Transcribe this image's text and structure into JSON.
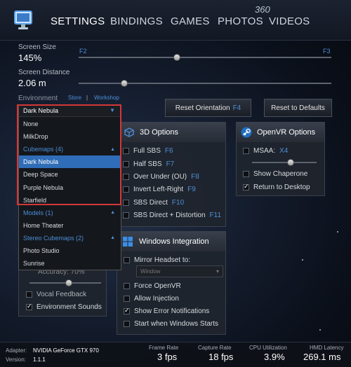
{
  "nav": {
    "tabs": [
      "SETTINGS",
      "BINDINGS",
      "GAMES",
      "PHOTOS",
      "VIDEOS"
    ],
    "photos_badge": "360"
  },
  "screen_size": {
    "label": "Screen Size",
    "value": "145%",
    "key_left": "F2",
    "key_right": "F3",
    "level": 0.39
  },
  "screen_distance": {
    "label": "Screen Distance",
    "value": "2.06 m",
    "level": 0.18
  },
  "environment": {
    "label": "Environment",
    "store": "Store",
    "workshop": "Workshop",
    "selected": "Dark Nebula",
    "list": [
      {
        "text": "None",
        "kind": "item"
      },
      {
        "text": "MilkDrop",
        "kind": "item"
      },
      {
        "text": "Cubemaps (4)",
        "kind": "category"
      },
      {
        "text": "Dark Nebula",
        "kind": "selected"
      },
      {
        "text": "Deep Space",
        "kind": "item"
      },
      {
        "text": "Purple Nebula",
        "kind": "item"
      },
      {
        "text": "Starfield",
        "kind": "item"
      },
      {
        "text": "Models (1)",
        "kind": "category"
      },
      {
        "text": "Home Theater",
        "kind": "item"
      },
      {
        "text": "Stereo Cubemaps (2)",
        "kind": "category"
      },
      {
        "text": "Photo Studio",
        "kind": "item"
      },
      {
        "text": "Sunrise",
        "kind": "item"
      }
    ]
  },
  "buttons": {
    "reset_orientation": "Reset Orientation",
    "reset_orientation_key": "F4",
    "reset_defaults": "Reset to Defaults"
  },
  "options3d": {
    "title": "3D Options",
    "items": [
      {
        "label": "Full SBS",
        "key": "F6",
        "checked": false
      },
      {
        "label": "Half SBS",
        "key": "F7",
        "checked": false
      },
      {
        "label": "Over Under (OU)",
        "key": "F8",
        "checked": false
      },
      {
        "label": "Invert Left-Right",
        "key": "F9",
        "checked": false
      },
      {
        "label": "SBS Direct",
        "key": "F10",
        "checked": false
      },
      {
        "label": "SBS Direct + Distortion",
        "key": "F11",
        "checked": false
      }
    ]
  },
  "openvr": {
    "title": "OpenVR Options",
    "msaa_label": "MSAA:",
    "msaa_value": "X4",
    "msaa_level": 0.6,
    "items": [
      {
        "label": "Show Chaperone",
        "checked": false
      },
      {
        "label": "Return to Desktop",
        "checked": true
      }
    ]
  },
  "windows": {
    "title": "Windows Integration",
    "mirror_label": "Mirror Headset to:",
    "mirror_value": "Window",
    "items": [
      {
        "label": "Force OpenVR",
        "checked": false
      },
      {
        "label": "Allow Injection",
        "checked": false
      },
      {
        "label": "Show Error Notifications",
        "checked": true
      },
      {
        "label": "Start when Windows Starts",
        "checked": false
      }
    ]
  },
  "left_panel": {
    "accuracy": "Accuracy: 70%",
    "accuracy_level": 0.55,
    "items": [
      {
        "label": "Vocal Feedback",
        "checked": false
      },
      {
        "label": "Environment Sounds",
        "checked": true
      }
    ]
  },
  "status": {
    "adapter_label": "Adapter:",
    "adapter_value": "NVIDIA GeForce GTX 970",
    "version_label": "Version:",
    "version_value": "1.1.1",
    "metrics": [
      {
        "label": "Frame Rate",
        "value": "3 fps"
      },
      {
        "label": "Capture Rate",
        "value": "18 fps"
      },
      {
        "label": "CPU Utilization",
        "value": "3.9%"
      },
      {
        "label": "HMD Latency",
        "value": "269.1 ms"
      }
    ]
  },
  "colors": {
    "accent": "#4d8fd6",
    "highlight": "#d43737",
    "selected_row": "#2f6db8"
  }
}
